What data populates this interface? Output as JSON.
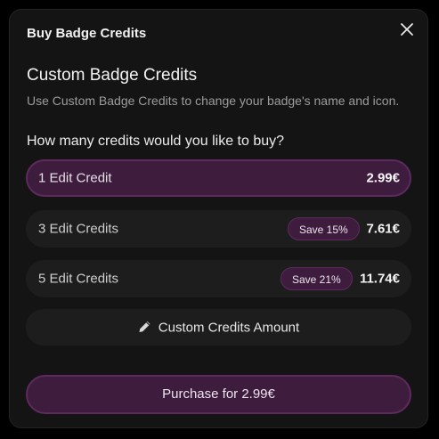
{
  "modal": {
    "title": "Buy Badge Credits",
    "close_icon": "close-icon"
  },
  "section": {
    "title": "Custom Badge Credits",
    "description": "Use Custom Badge Credits to change your badge's name and icon."
  },
  "question": "How many credits would you like to buy?",
  "options": [
    {
      "label": "1 Edit Credit",
      "price": "2.99€",
      "badge": "",
      "selected": true
    },
    {
      "label": "3 Edit Credits",
      "price": "7.61€",
      "badge": "Save 15%",
      "selected": false
    },
    {
      "label": "5 Edit Credits",
      "price": "11.74€",
      "badge": "Save 21%",
      "selected": false
    }
  ],
  "custom_amount": {
    "label": "Custom Credits Amount",
    "icon": "pencil-icon"
  },
  "purchase": {
    "label": "Purchase for 2.99€"
  },
  "colors": {
    "accent_fill": "#3e1c3e",
    "accent_border": "#5e2a5e",
    "panel": "#141414",
    "row": "#1d1d1d"
  }
}
